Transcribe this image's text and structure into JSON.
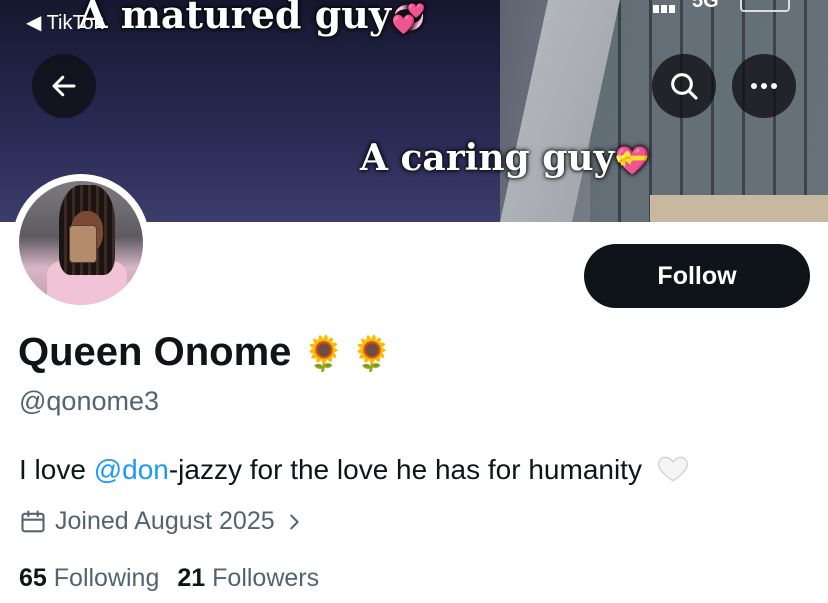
{
  "status_bar": {
    "back_label": "◀ TikTok",
    "carrier": "5G"
  },
  "banner": {
    "caption_top": "A matured guy",
    "caption_bottom": "A caring guy",
    "heart_top": "💞",
    "heart_bottom": "💝"
  },
  "profile": {
    "display_name": "Queen Onome",
    "name_emoji": "🌻🌻",
    "handle": "@qonome3",
    "bio": {
      "prefix": "I love ",
      "mention": "@don",
      "suffix": "-jazzy for the love he has for humanity"
    },
    "joined": "Joined August 2025",
    "following_count": "65",
    "following_label": "Following",
    "followers_count": "21",
    "followers_label": "Followers"
  },
  "actions": {
    "follow_label": "Follow"
  },
  "icons": {
    "back": "arrow-left-icon",
    "search": "search-icon",
    "more": "more-horizontal-icon",
    "calendar": "calendar-icon",
    "chevron": "chevron-right-icon"
  },
  "colors": {
    "primary_text": "#0f1419",
    "secondary_text": "#536471",
    "link": "#1d9bf0",
    "button": "#0f1419"
  }
}
